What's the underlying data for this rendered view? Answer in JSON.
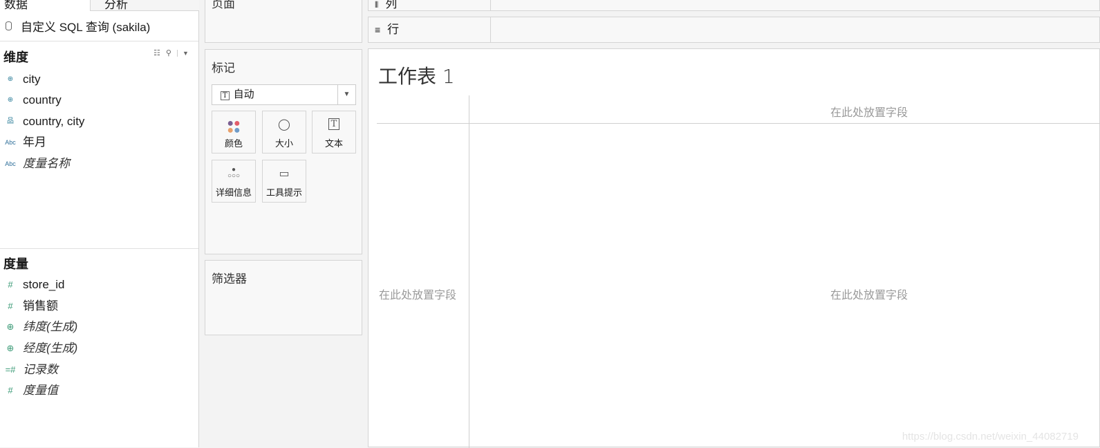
{
  "tabs": {
    "data": "数据",
    "analysis": "分析"
  },
  "datasource": {
    "name": "自定义 SQL 查询 (sakila)",
    "icon": "database-icon"
  },
  "dimensions": {
    "title": "维度",
    "items": [
      {
        "label": "city",
        "icon": "globe-icon",
        "italic": false
      },
      {
        "label": "country",
        "icon": "globe-icon",
        "italic": false
      },
      {
        "label": "country, city",
        "icon": "hierarchy-icon",
        "italic": false
      },
      {
        "label": "年月",
        "icon": "abc-icon",
        "italic": false
      },
      {
        "label": "度量名称",
        "icon": "abc-icon",
        "italic": true
      }
    ]
  },
  "measures": {
    "title": "度量",
    "items": [
      {
        "label": "store_id",
        "icon": "hash-icon"
      },
      {
        "label": "销售额",
        "icon": "hash-icon"
      },
      {
        "label": "纬度(生成)",
        "icon": "globe-icon"
      },
      {
        "label": "经度(生成)",
        "icon": "globe-icon"
      },
      {
        "label": "记录数",
        "icon": "hash-icon"
      },
      {
        "label": "度量值",
        "icon": "hash-icon"
      }
    ]
  },
  "cards": {
    "pages": "页面",
    "marks": "标记",
    "filters": "筛选器"
  },
  "marks": {
    "type": "自动",
    "buttons": {
      "color": "颜色",
      "size": "大小",
      "text": "文本",
      "detail": "详细信息",
      "tooltip": "工具提示"
    }
  },
  "shelves": {
    "columns": "列",
    "rows": "行"
  },
  "sheet": {
    "title": "工作表 1",
    "drop_top": "在此处放置字段",
    "drop_left": "在此处放置字段",
    "drop_center": "在此处放置字段"
  },
  "watermark": "https://blog.csdn.net/weixin_44082719"
}
